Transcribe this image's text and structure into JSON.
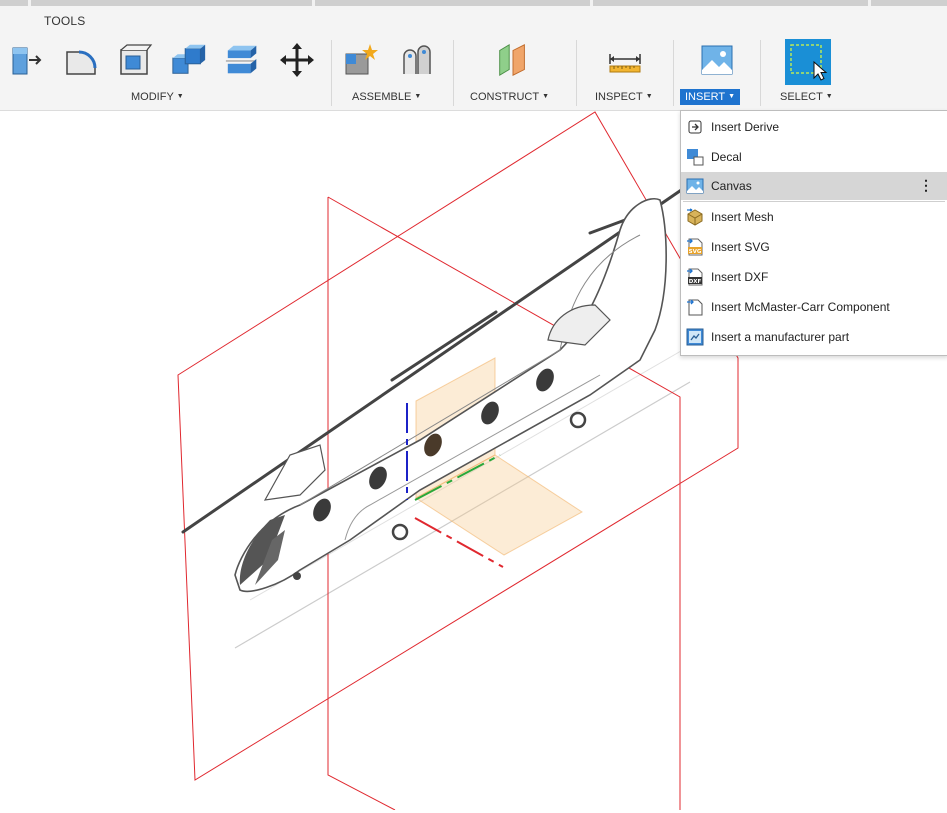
{
  "toolbar": {
    "section_title": "TOOLS",
    "groups": [
      {
        "label": "MODIFY"
      },
      {
        "label": "ASSEMBLE"
      },
      {
        "label": "CONSTRUCT"
      },
      {
        "label": "INSPECT"
      },
      {
        "label": "INSERT"
      },
      {
        "label": "SELECT"
      }
    ]
  },
  "insert_menu": {
    "items": [
      {
        "label": "Insert Derive",
        "icon": "insert-derive-icon"
      },
      {
        "label": "Decal",
        "icon": "decal-icon"
      },
      {
        "label": "Canvas",
        "icon": "canvas-icon"
      },
      {
        "label": "Insert Mesh",
        "icon": "insert-mesh-icon"
      },
      {
        "label": "Insert SVG",
        "icon": "insert-svg-icon"
      },
      {
        "label": "Insert DXF",
        "icon": "insert-dxf-icon"
      },
      {
        "label": "Insert McMaster-Carr Component",
        "icon": "mcmaster-icon"
      },
      {
        "label": "Insert a manufacturer part",
        "icon": "manufacturer-part-icon"
      }
    ],
    "more_glyph": "⋮",
    "highlighted_item": "Canvas"
  },
  "icon_glyphs": {
    "svg_badge": "SVG",
    "dxf_badge": "DXF"
  },
  "colors": {
    "accent_blue": "#1e73cf",
    "select_blue": "#1a8fd6",
    "plane_red": "#e0282f",
    "axis_blue": "#1c22c7",
    "axis_green": "#2aa83a",
    "plane_orange": "#f7c98a"
  }
}
